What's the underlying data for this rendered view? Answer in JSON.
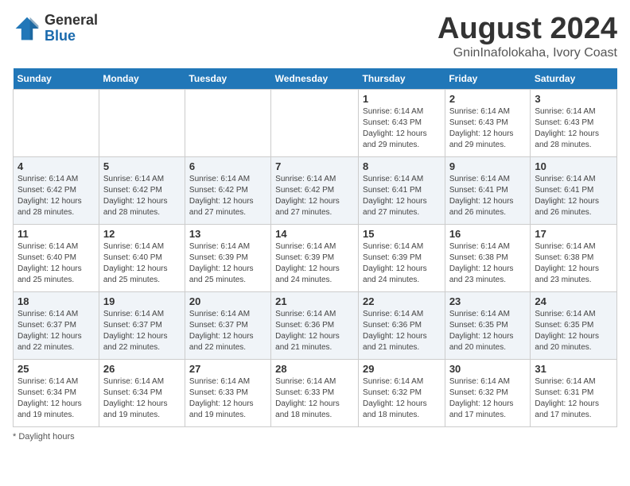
{
  "header": {
    "logo_general": "General",
    "logo_blue": "Blue",
    "month": "August 2024",
    "location": "GninInafolokaha, Ivory Coast"
  },
  "columns": [
    "Sunday",
    "Monday",
    "Tuesday",
    "Wednesday",
    "Thursday",
    "Friday",
    "Saturday"
  ],
  "weeks": [
    [
      {
        "day": "",
        "sunrise": "",
        "sunset": "",
        "daylight": ""
      },
      {
        "day": "",
        "sunrise": "",
        "sunset": "",
        "daylight": ""
      },
      {
        "day": "",
        "sunrise": "",
        "sunset": "",
        "daylight": ""
      },
      {
        "day": "",
        "sunrise": "",
        "sunset": "",
        "daylight": ""
      },
      {
        "day": "1",
        "sunrise": "Sunrise: 6:14 AM",
        "sunset": "Sunset: 6:43 PM",
        "daylight": "Daylight: 12 hours and 29 minutes."
      },
      {
        "day": "2",
        "sunrise": "Sunrise: 6:14 AM",
        "sunset": "Sunset: 6:43 PM",
        "daylight": "Daylight: 12 hours and 29 minutes."
      },
      {
        "day": "3",
        "sunrise": "Sunrise: 6:14 AM",
        "sunset": "Sunset: 6:43 PM",
        "daylight": "Daylight: 12 hours and 28 minutes."
      }
    ],
    [
      {
        "day": "4",
        "sunrise": "Sunrise: 6:14 AM",
        "sunset": "Sunset: 6:42 PM",
        "daylight": "Daylight: 12 hours and 28 minutes."
      },
      {
        "day": "5",
        "sunrise": "Sunrise: 6:14 AM",
        "sunset": "Sunset: 6:42 PM",
        "daylight": "Daylight: 12 hours and 28 minutes."
      },
      {
        "day": "6",
        "sunrise": "Sunrise: 6:14 AM",
        "sunset": "Sunset: 6:42 PM",
        "daylight": "Daylight: 12 hours and 27 minutes."
      },
      {
        "day": "7",
        "sunrise": "Sunrise: 6:14 AM",
        "sunset": "Sunset: 6:42 PM",
        "daylight": "Daylight: 12 hours and 27 minutes."
      },
      {
        "day": "8",
        "sunrise": "Sunrise: 6:14 AM",
        "sunset": "Sunset: 6:41 PM",
        "daylight": "Daylight: 12 hours and 27 minutes."
      },
      {
        "day": "9",
        "sunrise": "Sunrise: 6:14 AM",
        "sunset": "Sunset: 6:41 PM",
        "daylight": "Daylight: 12 hours and 26 minutes."
      },
      {
        "day": "10",
        "sunrise": "Sunrise: 6:14 AM",
        "sunset": "Sunset: 6:41 PM",
        "daylight": "Daylight: 12 hours and 26 minutes."
      }
    ],
    [
      {
        "day": "11",
        "sunrise": "Sunrise: 6:14 AM",
        "sunset": "Sunset: 6:40 PM",
        "daylight": "Daylight: 12 hours and 25 minutes."
      },
      {
        "day": "12",
        "sunrise": "Sunrise: 6:14 AM",
        "sunset": "Sunset: 6:40 PM",
        "daylight": "Daylight: 12 hours and 25 minutes."
      },
      {
        "day": "13",
        "sunrise": "Sunrise: 6:14 AM",
        "sunset": "Sunset: 6:39 PM",
        "daylight": "Daylight: 12 hours and 25 minutes."
      },
      {
        "day": "14",
        "sunrise": "Sunrise: 6:14 AM",
        "sunset": "Sunset: 6:39 PM",
        "daylight": "Daylight: 12 hours and 24 minutes."
      },
      {
        "day": "15",
        "sunrise": "Sunrise: 6:14 AM",
        "sunset": "Sunset: 6:39 PM",
        "daylight": "Daylight: 12 hours and 24 minutes."
      },
      {
        "day": "16",
        "sunrise": "Sunrise: 6:14 AM",
        "sunset": "Sunset: 6:38 PM",
        "daylight": "Daylight: 12 hours and 23 minutes."
      },
      {
        "day": "17",
        "sunrise": "Sunrise: 6:14 AM",
        "sunset": "Sunset: 6:38 PM",
        "daylight": "Daylight: 12 hours and 23 minutes."
      }
    ],
    [
      {
        "day": "18",
        "sunrise": "Sunrise: 6:14 AM",
        "sunset": "Sunset: 6:37 PM",
        "daylight": "Daylight: 12 hours and 22 minutes."
      },
      {
        "day": "19",
        "sunrise": "Sunrise: 6:14 AM",
        "sunset": "Sunset: 6:37 PM",
        "daylight": "Daylight: 12 hours and 22 minutes."
      },
      {
        "day": "20",
        "sunrise": "Sunrise: 6:14 AM",
        "sunset": "Sunset: 6:37 PM",
        "daylight": "Daylight: 12 hours and 22 minutes."
      },
      {
        "day": "21",
        "sunrise": "Sunrise: 6:14 AM",
        "sunset": "Sunset: 6:36 PM",
        "daylight": "Daylight: 12 hours and 21 minutes."
      },
      {
        "day": "22",
        "sunrise": "Sunrise: 6:14 AM",
        "sunset": "Sunset: 6:36 PM",
        "daylight": "Daylight: 12 hours and 21 minutes."
      },
      {
        "day": "23",
        "sunrise": "Sunrise: 6:14 AM",
        "sunset": "Sunset: 6:35 PM",
        "daylight": "Daylight: 12 hours and 20 minutes."
      },
      {
        "day": "24",
        "sunrise": "Sunrise: 6:14 AM",
        "sunset": "Sunset: 6:35 PM",
        "daylight": "Daylight: 12 hours and 20 minutes."
      }
    ],
    [
      {
        "day": "25",
        "sunrise": "Sunrise: 6:14 AM",
        "sunset": "Sunset: 6:34 PM",
        "daylight": "Daylight: 12 hours and 19 minutes."
      },
      {
        "day": "26",
        "sunrise": "Sunrise: 6:14 AM",
        "sunset": "Sunset: 6:34 PM",
        "daylight": "Daylight: 12 hours and 19 minutes."
      },
      {
        "day": "27",
        "sunrise": "Sunrise: 6:14 AM",
        "sunset": "Sunset: 6:33 PM",
        "daylight": "Daylight: 12 hours and 19 minutes."
      },
      {
        "day": "28",
        "sunrise": "Sunrise: 6:14 AM",
        "sunset": "Sunset: 6:33 PM",
        "daylight": "Daylight: 12 hours and 18 minutes."
      },
      {
        "day": "29",
        "sunrise": "Sunrise: 6:14 AM",
        "sunset": "Sunset: 6:32 PM",
        "daylight": "Daylight: 12 hours and 18 minutes."
      },
      {
        "day": "30",
        "sunrise": "Sunrise: 6:14 AM",
        "sunset": "Sunset: 6:32 PM",
        "daylight": "Daylight: 12 hours and 17 minutes."
      },
      {
        "day": "31",
        "sunrise": "Sunrise: 6:14 AM",
        "sunset": "Sunset: 6:31 PM",
        "daylight": "Daylight: 12 hours and 17 minutes."
      }
    ]
  ],
  "footer": "Daylight hours"
}
